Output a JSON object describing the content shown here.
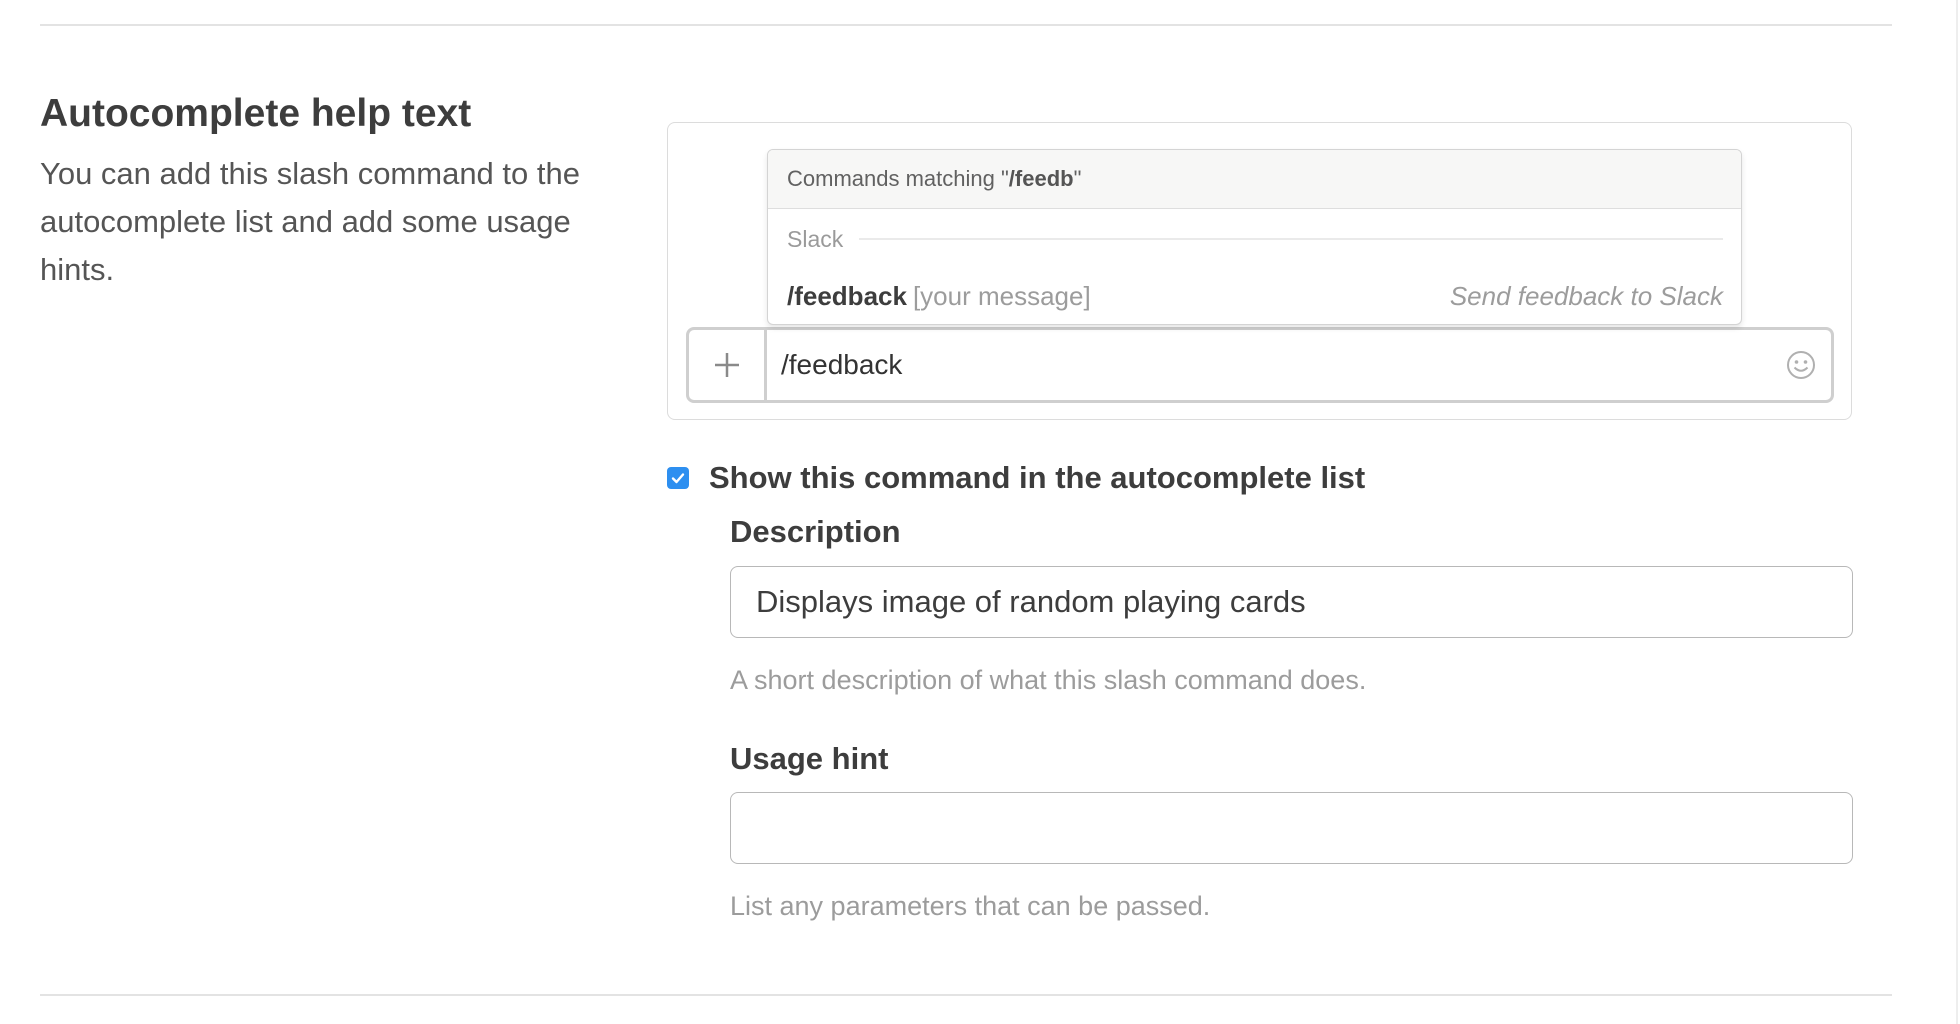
{
  "section": {
    "title": "Autocomplete help text",
    "description": "You can add this slash command to the autocomplete list and add some usage hints."
  },
  "preview": {
    "popup": {
      "header_prefix": "Commands matching \"",
      "query": "/feedb",
      "header_suffix": "\"",
      "group_label": "Slack",
      "item": {
        "command": "/feedback",
        "hint": "[your message]",
        "description": "Send feedback to Slack"
      }
    },
    "input": {
      "value": "/feedback",
      "plus_icon": "plus-icon",
      "emoji_icon": "smiley-icon"
    }
  },
  "autocomplete_toggle": {
    "label": "Show this command in the autocomplete list",
    "checked": true,
    "color": "#2d8ff0"
  },
  "description_field": {
    "label": "Description",
    "value": "Displays image of random playing cards",
    "help": "A short description of what this slash command does."
  },
  "usage_hint_field": {
    "label": "Usage hint",
    "value": "",
    "help": "List any parameters that can be passed."
  }
}
